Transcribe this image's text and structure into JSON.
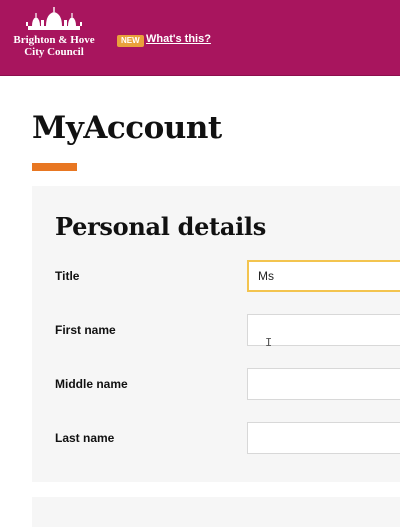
{
  "header": {
    "logo_line1": "Brighton & Hove",
    "logo_line2": "City Council",
    "new_badge": "NEW",
    "whats_this": "What's this?"
  },
  "page": {
    "title": "MyAccount"
  },
  "personal_details": {
    "heading": "Personal details",
    "fields": [
      {
        "label": "Title",
        "value": "Ms"
      },
      {
        "label": "First name",
        "value": ""
      },
      {
        "label": "Middle name",
        "value": ""
      },
      {
        "label": "Last name",
        "value": ""
      }
    ]
  },
  "colors": {
    "brand": "#a8155e",
    "accent": "#e87722",
    "focus": "#f3c44f"
  }
}
